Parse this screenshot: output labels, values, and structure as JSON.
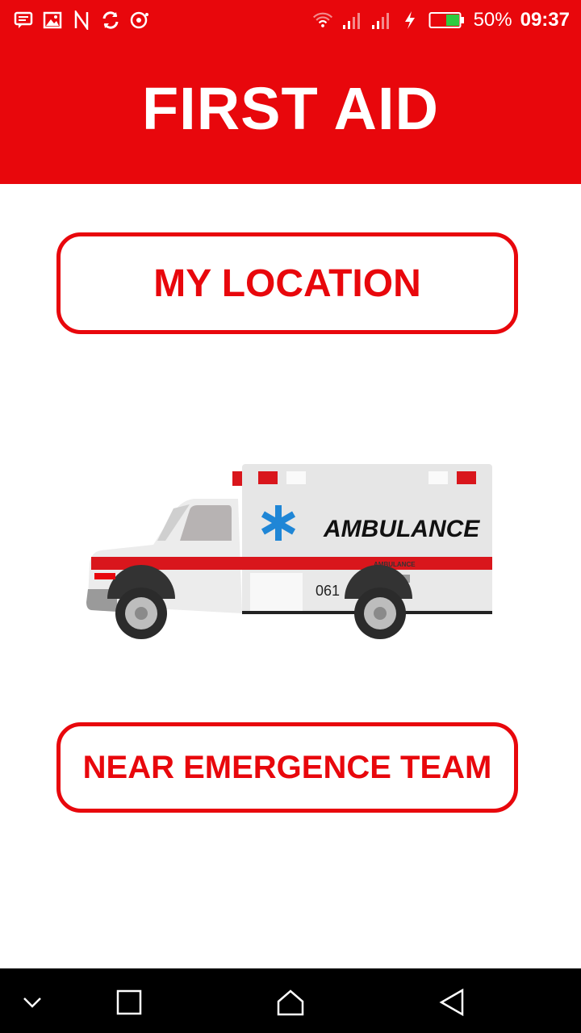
{
  "status_bar": {
    "battery_percent": "50%",
    "time": "09:37",
    "icons_left": [
      "message-icon",
      "image-icon",
      "n-icon",
      "sync-icon",
      "media-icon"
    ],
    "icons_right": [
      "wifi-icon",
      "signal-icon",
      "signal-icon-2",
      "charging-icon",
      "battery-icon"
    ]
  },
  "app_bar": {
    "title": "FIRST AID"
  },
  "main": {
    "location_button": "MY LOCATION",
    "team_button": "NEAR EMERGENCE TEAM",
    "ambulance_image": {
      "side_text": "AMBULANCE",
      "small_text": "AMBULANCE",
      "number": "061"
    }
  },
  "nav_bar": {
    "buttons": [
      "chevron-down-icon",
      "recents-icon",
      "home-icon",
      "back-icon"
    ]
  },
  "colors": {
    "primary": "#e8070c",
    "background": "#ffffff",
    "navbar": "#000000"
  }
}
